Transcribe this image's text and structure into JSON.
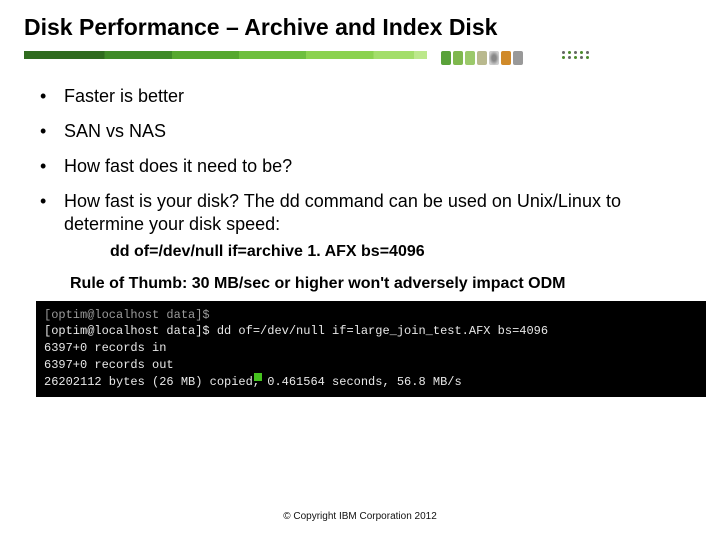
{
  "title": "Disk Performance – Archive and Index Disk",
  "bullets": {
    "b1": "Faster is better",
    "b2": "SAN vs NAS",
    "b3": "How fast does it need to be?",
    "b4": "How fast is your disk? The dd command can be used on Unix/Linux to determine your disk speed:"
  },
  "command_example": "dd of=/dev/null if=archive 1. AFX bs=4096",
  "rule_of_thumb": "Rule of Thumb: 30 MB/sec or higher won't adversely impact ODM",
  "terminal": {
    "l1": "[optim@localhost data]$",
    "l2": "[optim@localhost data]$ dd of=/dev/null if=large_join_test.AFX bs=4096",
    "l3": "6397+0 records in",
    "l4": "6397+0 records out",
    "l5": "26202112 bytes (26 MB) copied, 0.461564 seconds, 56.8 MB/s"
  },
  "footer": "© Copyright IBM Corporation 2012"
}
